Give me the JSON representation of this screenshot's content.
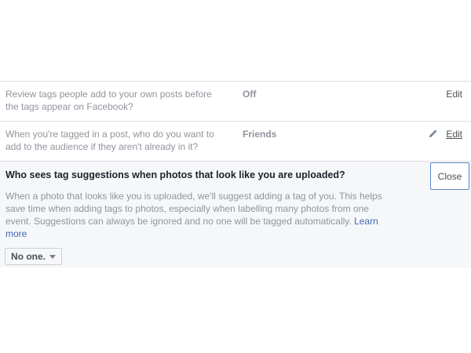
{
  "settings": {
    "rows": [
      {
        "question": "Review tags people add to your own posts before the tags appear on Facebook?",
        "value": "Off",
        "edit_label": "Edit"
      },
      {
        "question": "When you're tagged in a post, who do you want to add to the audience if they aren't already in it?",
        "value": "Friends",
        "edit_label": "Edit",
        "edit_icon": "pencil-icon"
      }
    ],
    "expanded": {
      "heading": "Who sees tag suggestions when photos that look like you are uploaded?",
      "description": "When a photo that looks like you is uploaded, we'll suggest adding a tag of you. This helps save time when adding tags to photos, especially when labelling many photos from one event. Suggestions can always be ignored and no one will be tagged automatically.",
      "learn_more": "Learn more",
      "close_label": "Close",
      "selected_option": "No one.",
      "dropdown_icon": "caret-down-icon"
    }
  },
  "colors": {
    "link": "#4267b2",
    "muted_text": "#90949c",
    "heading_text": "#1d2129",
    "expanded_bg": "#f6f7f9",
    "close_border": "#5f85c4"
  }
}
